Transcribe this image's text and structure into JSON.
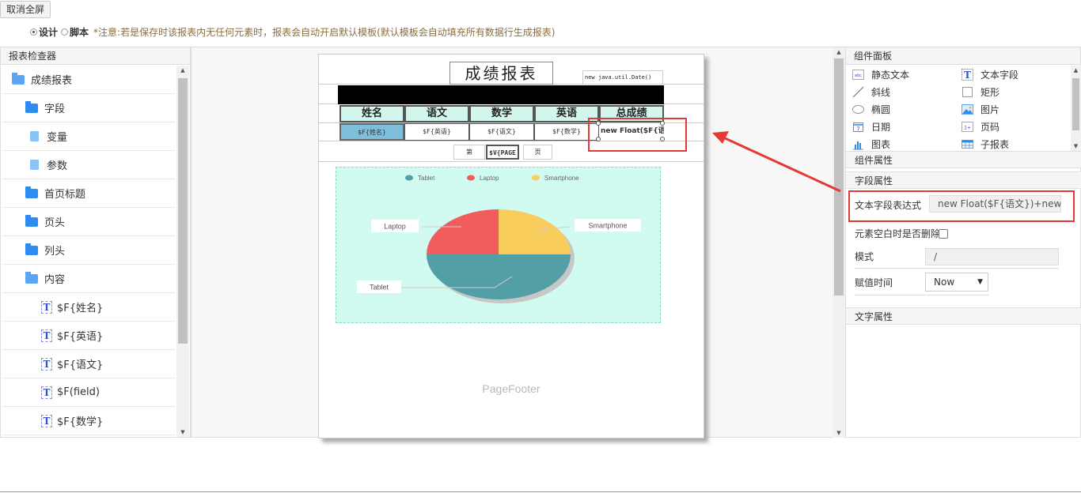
{
  "toolbar": {
    "exit_fullscreen": "取消全屏",
    "mode_design": "设计",
    "mode_script": "脚本",
    "notice": "*注意:若是保存时该报表内无任何元素时，报表会自动开启默认模板(默认模板会自动填充所有数据行生成报表)"
  },
  "inspector": {
    "title": "报表检查器",
    "items": [
      {
        "label": "成绩报表",
        "icon": "folder-open-icon"
      },
      {
        "label": "字段",
        "icon": "folder-icon"
      },
      {
        "label": "变量",
        "icon": "file-icon"
      },
      {
        "label": "参数",
        "icon": "file-icon"
      },
      {
        "label": "首页标题",
        "icon": "folder-icon"
      },
      {
        "label": "页头",
        "icon": "folder-icon"
      },
      {
        "label": "列头",
        "icon": "folder-icon"
      },
      {
        "label": "内容",
        "icon": "folder-open-icon"
      },
      {
        "label": "$F{姓名}",
        "icon": "text-field-icon"
      },
      {
        "label": "$F{英语}",
        "icon": "text-field-icon"
      },
      {
        "label": "$F{语文}",
        "icon": "text-field-icon"
      },
      {
        "label": "$F(field)",
        "icon": "text-field-icon"
      },
      {
        "label": "$F{数学}",
        "icon": "text-field-icon"
      }
    ]
  },
  "report": {
    "title": "成绩报表",
    "date_expr": "new java.util.Date()",
    "headers": [
      "姓名",
      "语文",
      "数学",
      "英语",
      "总成绩"
    ],
    "fields": [
      "$F{姓名}",
      "$F{英语}",
      "$F{语文}",
      "$F{数学}",
      "new Float($F{语"
    ],
    "page_prefix": "第",
    "page_var": "$V{PAGE",
    "page_suffix": "页",
    "footer": "PageFooter"
  },
  "chart_data": {
    "type": "pie",
    "categories": [
      "Tablet",
      "Laptop",
      "Smartphone"
    ],
    "values": [
      50,
      25,
      25
    ],
    "colors": [
      "#52a0a6",
      "#f35c5c",
      "#f9cd5c"
    ],
    "legend": "top",
    "title": ""
  },
  "components": {
    "title": "组件面板",
    "items": [
      {
        "label": "静态文本",
        "icon": "static-text-icon"
      },
      {
        "label": "文本字段",
        "icon": "text-field-icon"
      },
      {
        "label": "斜线",
        "icon": "line-icon"
      },
      {
        "label": "矩形",
        "icon": "rectangle-icon"
      },
      {
        "label": "椭圆",
        "icon": "ellipse-icon"
      },
      {
        "label": "图片",
        "icon": "image-icon"
      },
      {
        "label": "日期",
        "icon": "calendar-icon"
      },
      {
        "label": "页码",
        "icon": "page-number-icon"
      },
      {
        "label": "图表",
        "icon": "chart-icon"
      },
      {
        "label": "子报表",
        "icon": "subreport-icon"
      }
    ]
  },
  "properties": {
    "component_props": "组件属性",
    "field_props": "字段属性",
    "expr_label": "文本字段表达式",
    "expr_value": "new Float($F{语文})+new F",
    "remove_blank_label": "元素空白时是否删除",
    "pattern_label": "模式",
    "pattern_value": "/",
    "eval_time_label": "赋值时间",
    "eval_time_value": "Now",
    "text_props": "文字属性"
  },
  "colors": {
    "annotation": "#e53935",
    "accent": "#2e8cf0"
  }
}
